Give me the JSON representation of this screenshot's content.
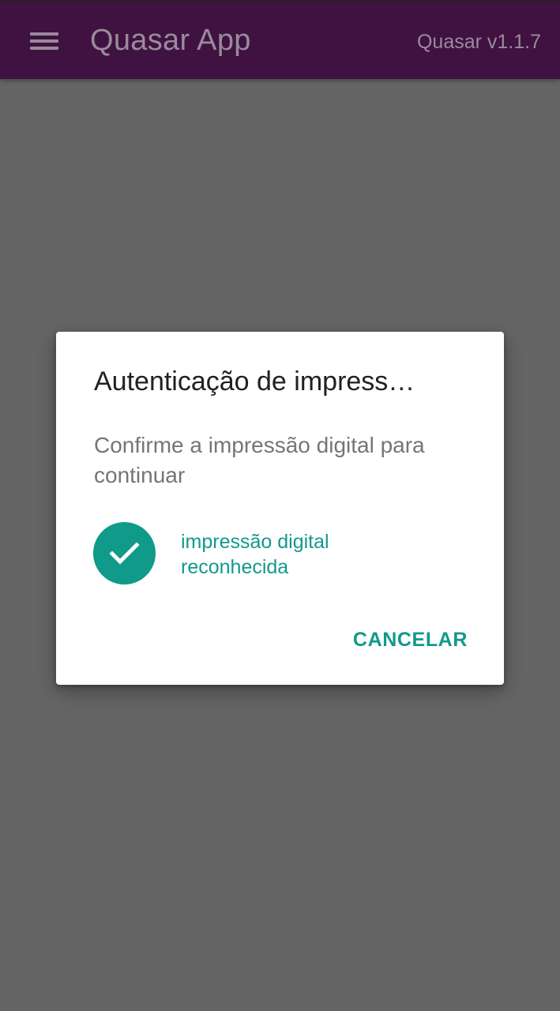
{
  "app_bar": {
    "title": "Quasar App",
    "version": "Quasar v1.1.7",
    "menu_icon": "menu-icon",
    "background": "#3f1241"
  },
  "dialog": {
    "title": "Autenticação de impress…",
    "description": "Confirme a impressão digital para continuar",
    "status_icon": "check-icon",
    "status_text": "impressão digital reconhecida",
    "cancel_label": "CANCELAR",
    "accent": "#12998b"
  },
  "backdrop_color": "#656565"
}
